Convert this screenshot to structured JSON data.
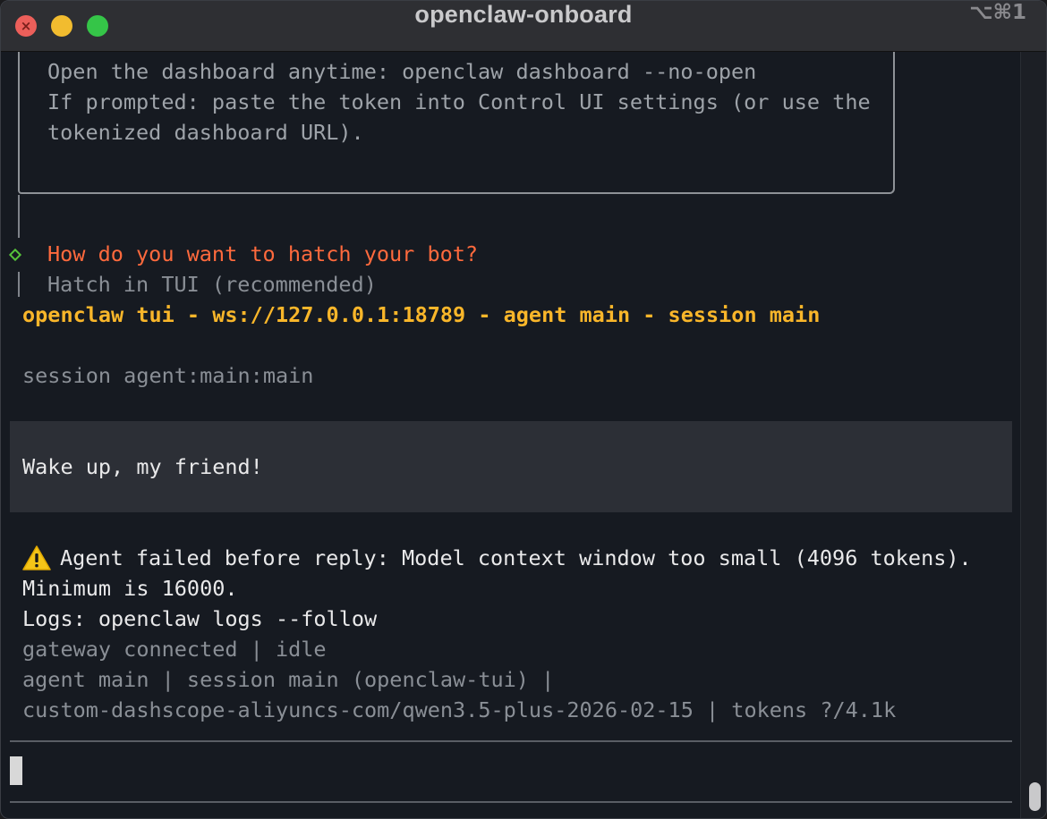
{
  "window": {
    "title": "openclaw-onboard",
    "shortcut": "⌥⌘1",
    "close_glyph": "×"
  },
  "box": {
    "lines": [
      "Open the dashboard anytime: openclaw dashboard --no-open",
      "If prompted: paste the token into Control UI settings (or use the",
      "tokenized dashboard URL)."
    ]
  },
  "prompt": {
    "question": "How do you want to hatch your bot?",
    "answer": "Hatch in TUI (recommended)"
  },
  "tui": {
    "header": "openclaw tui - ws://127.0.0.1:18789 - agent main - session main",
    "session_line": "session agent:main:main",
    "user_message": "Wake up, my friend!",
    "error_line1": "Agent failed before reply: Model context window too small (4096 tokens).",
    "error_line2": "Minimum is 16000.",
    "logs_line": "Logs: openclaw logs --follow",
    "status_line1": "gateway connected | idle",
    "status_line2": "agent main | session main (openclaw-tui) |",
    "status_line3": "custom-dashscope-aliyuncs-com/qwen3.5-plus-2026-02-15 | tokens ?/4.1k"
  },
  "icons": {
    "warning": "warning-icon",
    "select_marker": "diamond-marker-icon"
  },
  "colors": {
    "question": "#ff6a3d",
    "header": "#f9b62a",
    "marker": "#56c23a",
    "warning": "#f5c518"
  }
}
